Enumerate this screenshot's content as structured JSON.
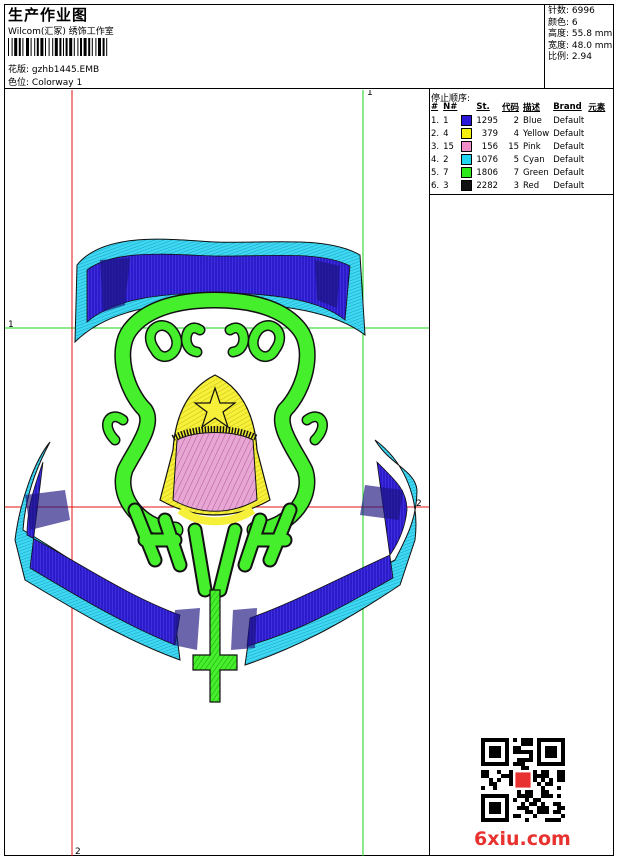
{
  "header": {
    "title": "生产作业图",
    "subtitle": "Wilcom(汇冢) 绣饰工作室",
    "design_label": "花版:",
    "design_value": "gzhb1445.EMB",
    "colorway_label": "色位:",
    "colorway_value": "Colorway 1"
  },
  "stats": {
    "stitches": "针数: 6996",
    "colors": "颜色: 6",
    "height": "高度: 55.8 mm",
    "width": "宽度: 48.0 mm",
    "scale": "比例: 2.94"
  },
  "sequence": {
    "title": "停止顺序:",
    "headers": [
      "#",
      "N#",
      "St.",
      "代码",
      "描述",
      "Brand",
      "元素"
    ],
    "rows": [
      {
        "idx": "1.",
        "n": "1",
        "color": "#2a17d9",
        "st": "1295",
        "code": "2",
        "desc": "Blue",
        "brand": "Default"
      },
      {
        "idx": "2.",
        "n": "4",
        "color": "#f5ef0c",
        "st": "379",
        "code": "4",
        "desc": "Yellow",
        "brand": "Default"
      },
      {
        "idx": "3.",
        "n": "15",
        "color": "#f08cc8",
        "st": "156",
        "code": "15",
        "desc": "Pink",
        "brand": "Default"
      },
      {
        "idx": "4.",
        "n": "2",
        "color": "#20d6f0",
        "st": "1076",
        "code": "5",
        "desc": "Cyan",
        "brand": "Default"
      },
      {
        "idx": "5.",
        "n": "7",
        "color": "#2cea1a",
        "st": "1806",
        "code": "7",
        "desc": "Green",
        "brand": "Default"
      },
      {
        "idx": "6.",
        "n": "3",
        "color": "#111111",
        "st": "2282",
        "code": "3",
        "desc": "Red",
        "brand": "Default"
      }
    ]
  },
  "guides": {
    "top_label": "1",
    "left_label": "1",
    "right_label": "2",
    "bottom_label": "2"
  },
  "watermark": "6xiu.com"
}
